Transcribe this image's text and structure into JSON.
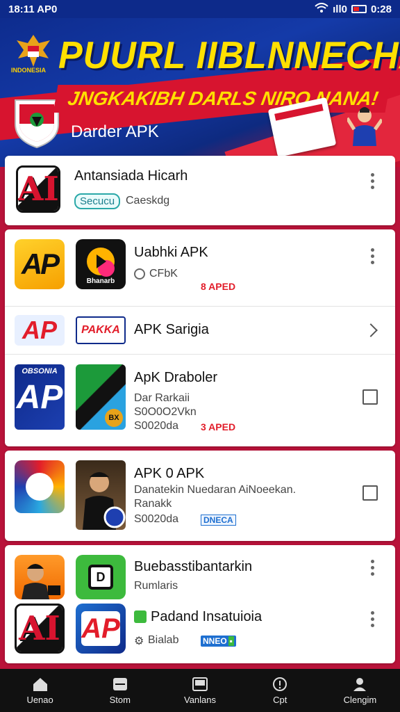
{
  "status_bar": {
    "time_left": "18:11 AP0",
    "time_right": "0:28",
    "signal": "ıll0"
  },
  "banner": {
    "emblem_label": "INDONESIA",
    "title": "PUURL IIBLNNECHA",
    "subtitle": "JNGKAKIBH DARLS NIRO NANA!",
    "brand": "Darder APK"
  },
  "apps": [
    {
      "title": "Antansiada Hicarh",
      "pill": "Secucu",
      "subtitle": "Caeskdg"
    },
    {
      "title": "Uabhki APK",
      "subtitle": "CFbK",
      "badge": "8 APED"
    },
    {
      "title": "APK Sarigia"
    },
    {
      "title": "ApK Draboler",
      "line1": "Dar Rarkaii",
      "line2": "S0O0O2Vkn",
      "line3": "S0020da",
      "badge": "3 APED"
    },
    {
      "title": "APK 0 APK",
      "line1": "Danatekin Nuedaran AiNoeekan.",
      "line2": "Ranakk",
      "line3": "S0020da",
      "badge": "DNECA"
    },
    {
      "title": "Buebasstibantarkin",
      "subtitle": "Rumlaris"
    },
    {
      "title": "Padand Insatuioia",
      "subtitle": "Bialab",
      "badge": "NNEO"
    }
  ],
  "icon_labels": {
    "ai": "AI",
    "ap": "AP",
    "dark_caption": "Bhanarb",
    "tag": "PAKKA",
    "dblue_caption": "OBSONIA",
    "coin": "BX"
  },
  "bottom_nav": [
    "Uenao",
    "Stom",
    "Vanlans",
    "Cpt",
    "Clengim"
  ]
}
